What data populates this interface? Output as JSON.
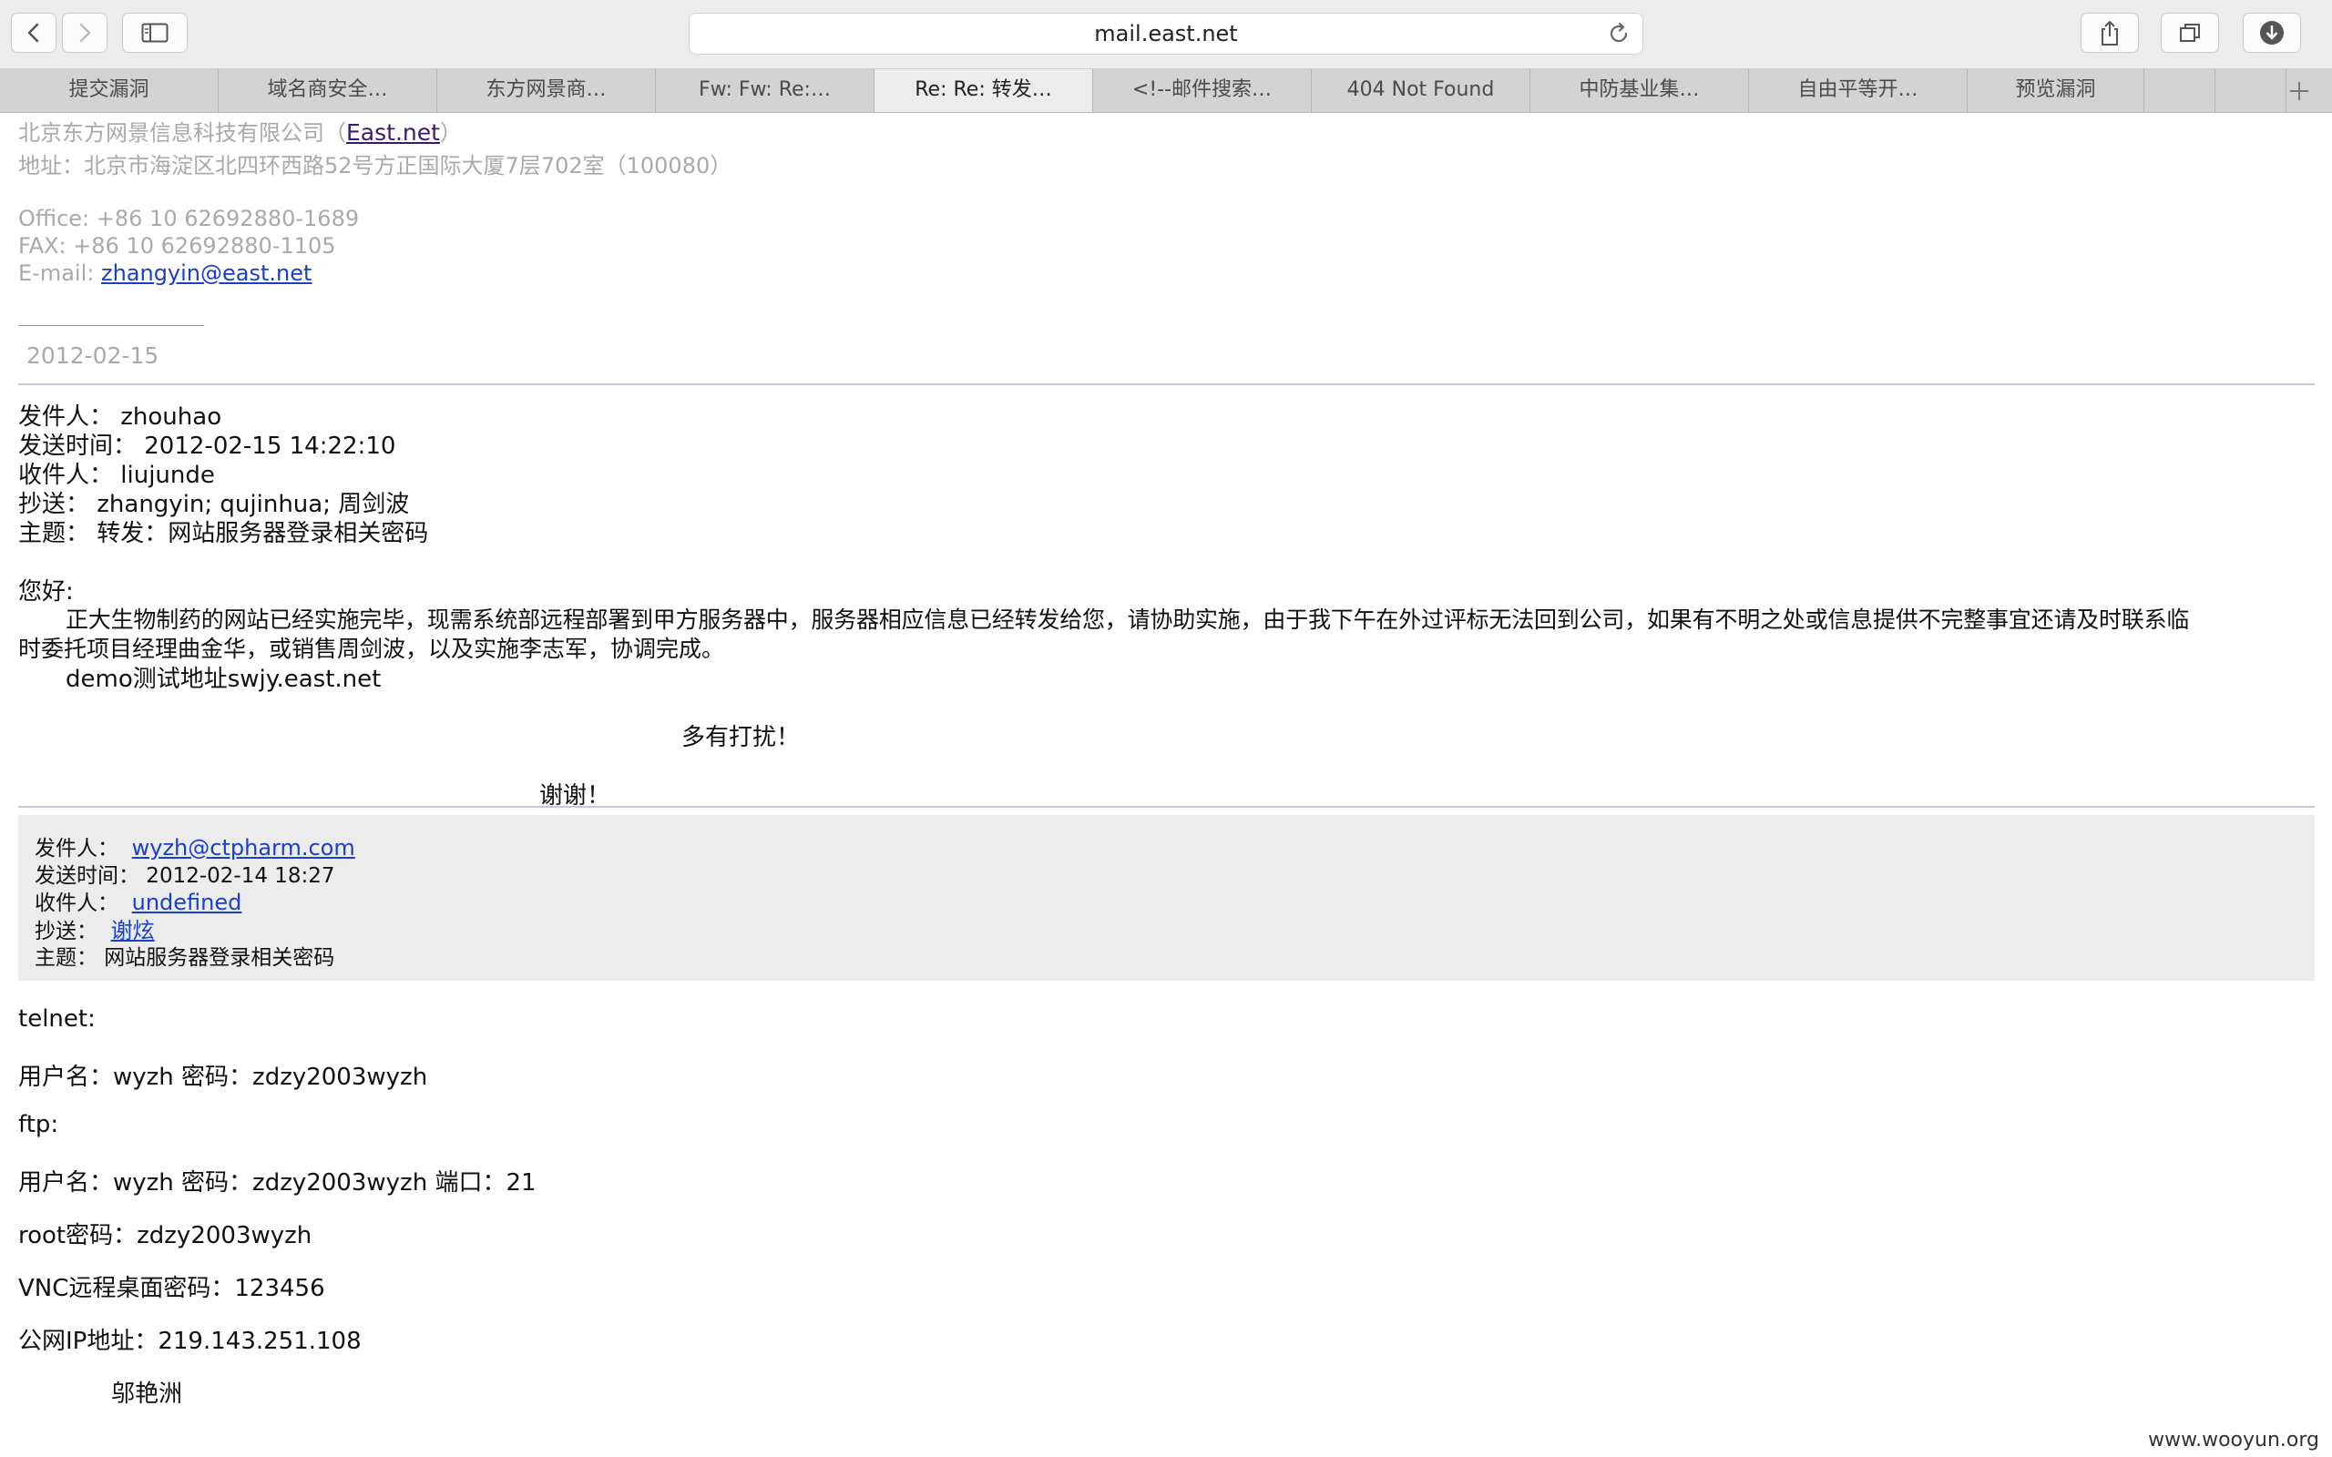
{
  "browser": {
    "url": "mail.east.net",
    "tabs": [
      {
        "label": "提交漏洞"
      },
      {
        "label": "域名商安全…"
      },
      {
        "label": "东方网景商…"
      },
      {
        "label": "Fw: Fw: Re:…"
      },
      {
        "label": "Re: Re: 转发…"
      },
      {
        "label": "<!--邮件搜索…"
      },
      {
        "label": "404 Not Found"
      },
      {
        "label": "中防基业集…"
      },
      {
        "label": "自由平等开…"
      },
      {
        "label": "预览漏洞"
      }
    ]
  },
  "signature": {
    "company": "北京东方网景信息科技有限公司（",
    "company_link": "East.net",
    "company_close": "）",
    "address": "地址：北京市海淀区北四环西路52号方正国际大厦7层702室（100080）",
    "office": "Office: +86 10 62692880-1689",
    "fax": "FAX: +86 10 62692880-1105",
    "email_label": "E-mail: ",
    "email": "zhangyin@east.net",
    "date": "2012-02-15"
  },
  "forward_header": {
    "from": "发件人：  zhouhao",
    "sent": "发送时间：  2012-02-15  14:22:10",
    "to": "收件人：  liujunde",
    "cc": "抄送：  zhangyin; qujinhua; 周剑波",
    "subject": "主题：  转发：网站服务器登录相关密码"
  },
  "body": {
    "greeting": "您好:",
    "paragraph_line1": "正大生物制药的网站已经实施完毕，现需系统部远程部署到甲方服务器中，服务器相应信息已经转发给您，请协助实施，由于我下午在外过评标无法回到公司，如果有不明之处或信息提供不完整事宜还请及时联系临",
    "paragraph_line2": "时委托项目经理曲金华，或销售周剑波，以及实施李志军，协调完成。",
    "demo": "demo测试地址swjy.east.net",
    "thanks1": "多有打扰！",
    "thanks2": "谢谢！"
  },
  "quoted_header": {
    "from_label": "发件人：",
    "from": "wyzh@ctpharm.com",
    "sent": "发送时间：  2012-02-14 18:27",
    "to_label": "收件人：",
    "to": "undefined",
    "cc_label": "抄送：",
    "cc": "谢炫",
    "subject": "主题：  网站服务器登录相关密码"
  },
  "credentials": {
    "telnet": "telnet:",
    "telnet_line": "用户名：wyzh 密码：zdzy2003wyzh",
    "ftp": "ftp:",
    "ftp_line": "用户名：wyzh 密码：zdzy2003wyzh    端口：21",
    "root": "root密码：zdzy2003wyzh",
    "vnc": "VNC远程桌面密码：123456",
    "ip": "公网IP地址：219.143.251.108",
    "signer": "邬艳洲"
  },
  "watermark": "www.wooyun.org"
}
